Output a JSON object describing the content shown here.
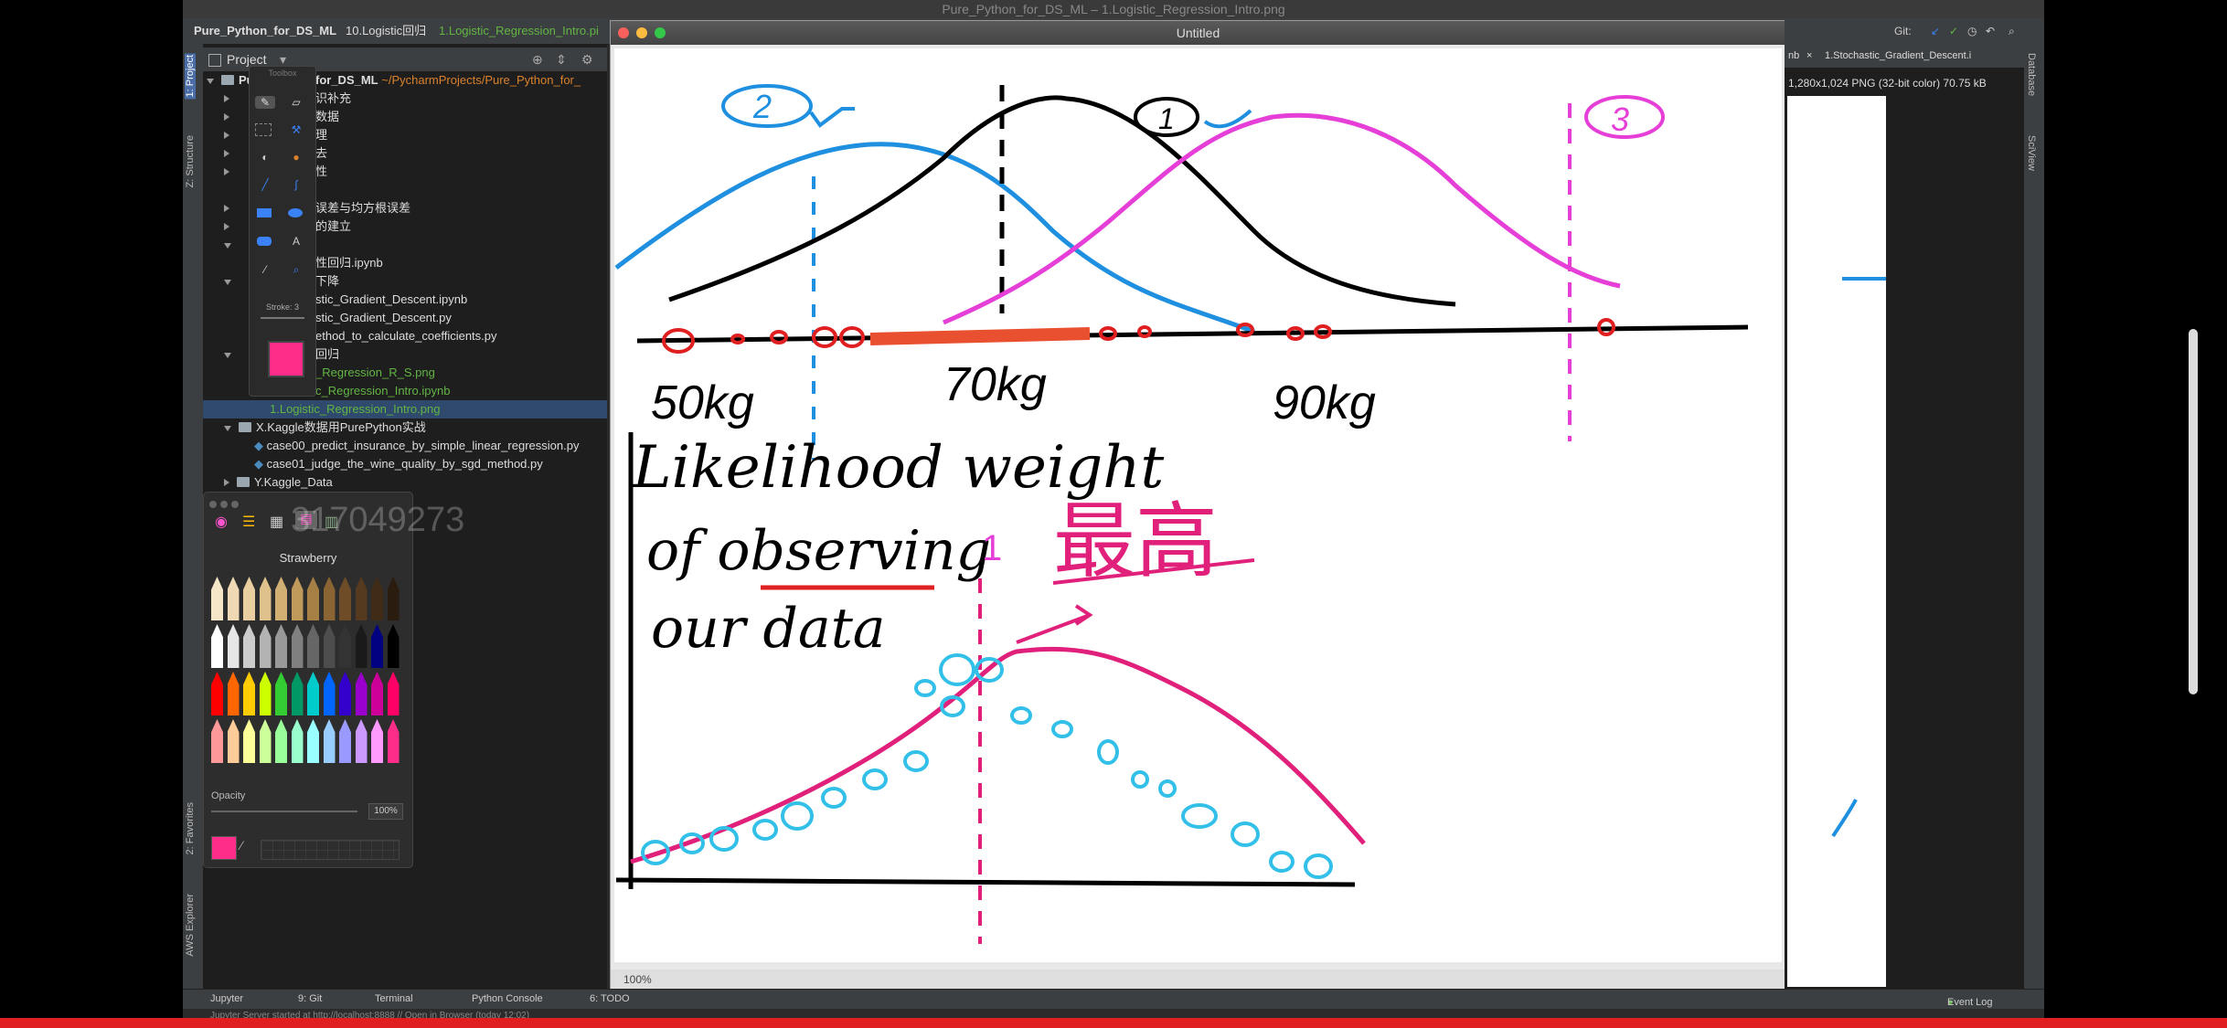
{
  "os_title": "Pure_Python_for_DS_ML – 1.Logistic_Regression_Intro.png",
  "nav": {
    "project": "Pure_Python_for_DS_ML",
    "folder": "10.Logistic回归",
    "file": "1.Logistic_Regression_Intro.pi"
  },
  "left_tabs": {
    "project": "1: Project",
    "structure": "Z: Structure",
    "favorites": "2: Favorites",
    "aws": "AWS Explorer"
  },
  "project_panel": {
    "header": "Project",
    "root_name": "Pu",
    "root_suffix": "for_DS_ML",
    "root_path": "~/PycharmProjects/Pure_Python_for_",
    "rows": [
      "识补充",
      "数据",
      "理",
      "去",
      "性",
      "误差与均方根误差",
      "的建立",
      "性回归.ipynb",
      "下降",
      "stic_Gradient_Descent.ipynb",
      "stic_Gradient_Descent.py",
      "ethod_to_calculate_coefficients.py",
      "回归",
      "_Regression_R_S.png",
      "c_Regression_Intro.ipynb",
      "1.Logistic_Regression_Intro.png",
      "X.Kaggle数据用PurePython实战",
      "case00_predict_insurance_by_simple_linear_regression.py",
      "case01_judge_the_wine_quality_by_sgd_method.py",
      "Y.Kaggle_Data"
    ]
  },
  "toolbox": {
    "title": "Toolbox",
    "stroke_label": "Stroke: 3"
  },
  "colors_panel": {
    "selected_name": "Strawberry",
    "opacity_label": "Opacity",
    "opacity_value": "100%",
    "selected_color": "#ff2d8a"
  },
  "watermark": "317049273",
  "preview": {
    "title": "Untitled",
    "zoom": "100%"
  },
  "drawing": {
    "label_2": "2",
    "label_1": "1",
    "label_3": "3",
    "w50": "50kg",
    "w70": "70kg",
    "w90": "90kg",
    "line1": "Likelihood weight",
    "line2": "of observing",
    "line3": "our data",
    "cn": "最高"
  },
  "right_panel": {
    "tab": "1.Stochastic_Gradient_Descent.i",
    "tab_prev": "nb",
    "info": "1,280x1,024 PNG (32-bit color) 70.75 kB",
    "git_label": "Git:",
    "database": "Database",
    "sciview": "SciView"
  },
  "bottom_bar": {
    "jupyter": "Jupyter",
    "git": "9: Git",
    "terminal": "Terminal",
    "python_console": "Python Console",
    "todo": "6: TODO",
    "event_log": "Event Log"
  },
  "status": "Jupyter Server started at http://localhost:8888 // Open in Browser (today 12:02)",
  "colors": {
    "blue": "#1f8fe0",
    "black": "#000000",
    "magenta": "#e53fd8",
    "red": "#e02020",
    "pink": "#e0207a",
    "cyan": "#33c0e8"
  }
}
